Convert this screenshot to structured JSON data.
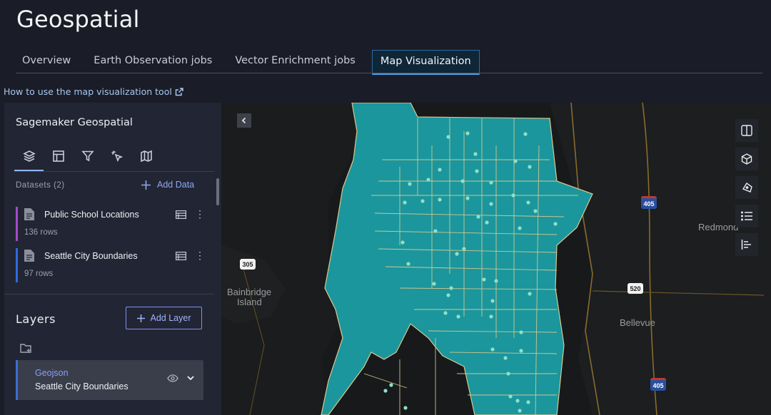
{
  "app": {
    "title": "Geospatial"
  },
  "tabs": [
    {
      "label": "Overview"
    },
    {
      "label": "Earth Observation jobs"
    },
    {
      "label": "Vector Enrichment jobs"
    },
    {
      "label": "Map Visualization"
    }
  ],
  "help_link": {
    "label": "How to use the map visualization tool"
  },
  "panel": {
    "title": "Sagemaker Geospatial",
    "tool_tabs": [
      "layers-icon",
      "table-icon",
      "filter-icon",
      "interaction-icon",
      "basemap-icon"
    ],
    "datasets_header": "Datasets (2)",
    "add_data_label": "Add Data",
    "datasets": [
      {
        "name": "Public School Locations",
        "rows": "136 rows",
        "color": "#a24bc9"
      },
      {
        "name": "Seattle City Boundaries",
        "rows": "97 rows",
        "color": "#2f6be0"
      }
    ],
    "layers_title": "Layers",
    "add_layer_label": "Add Layer",
    "layer": {
      "type": "Geojson",
      "name": "Seattle City Boundaries"
    }
  },
  "map": {
    "labels": {
      "redmond": "Redmond",
      "bainbridge_1": "Bainbridge",
      "bainbridge_2": "Island",
      "bellevue": "Bellevue",
      "r305": "305",
      "r405a": "405",
      "r520": "520",
      "r405b": "405"
    },
    "controls": [
      "split-map-icon",
      "3d-cube-icon",
      "draw-polygon-icon",
      "legend-list-icon",
      "bar-chart-icon"
    ],
    "fill_color": "#1b969c",
    "boundary_color": "#d9c98f",
    "point_color": "#8fe0c8"
  }
}
